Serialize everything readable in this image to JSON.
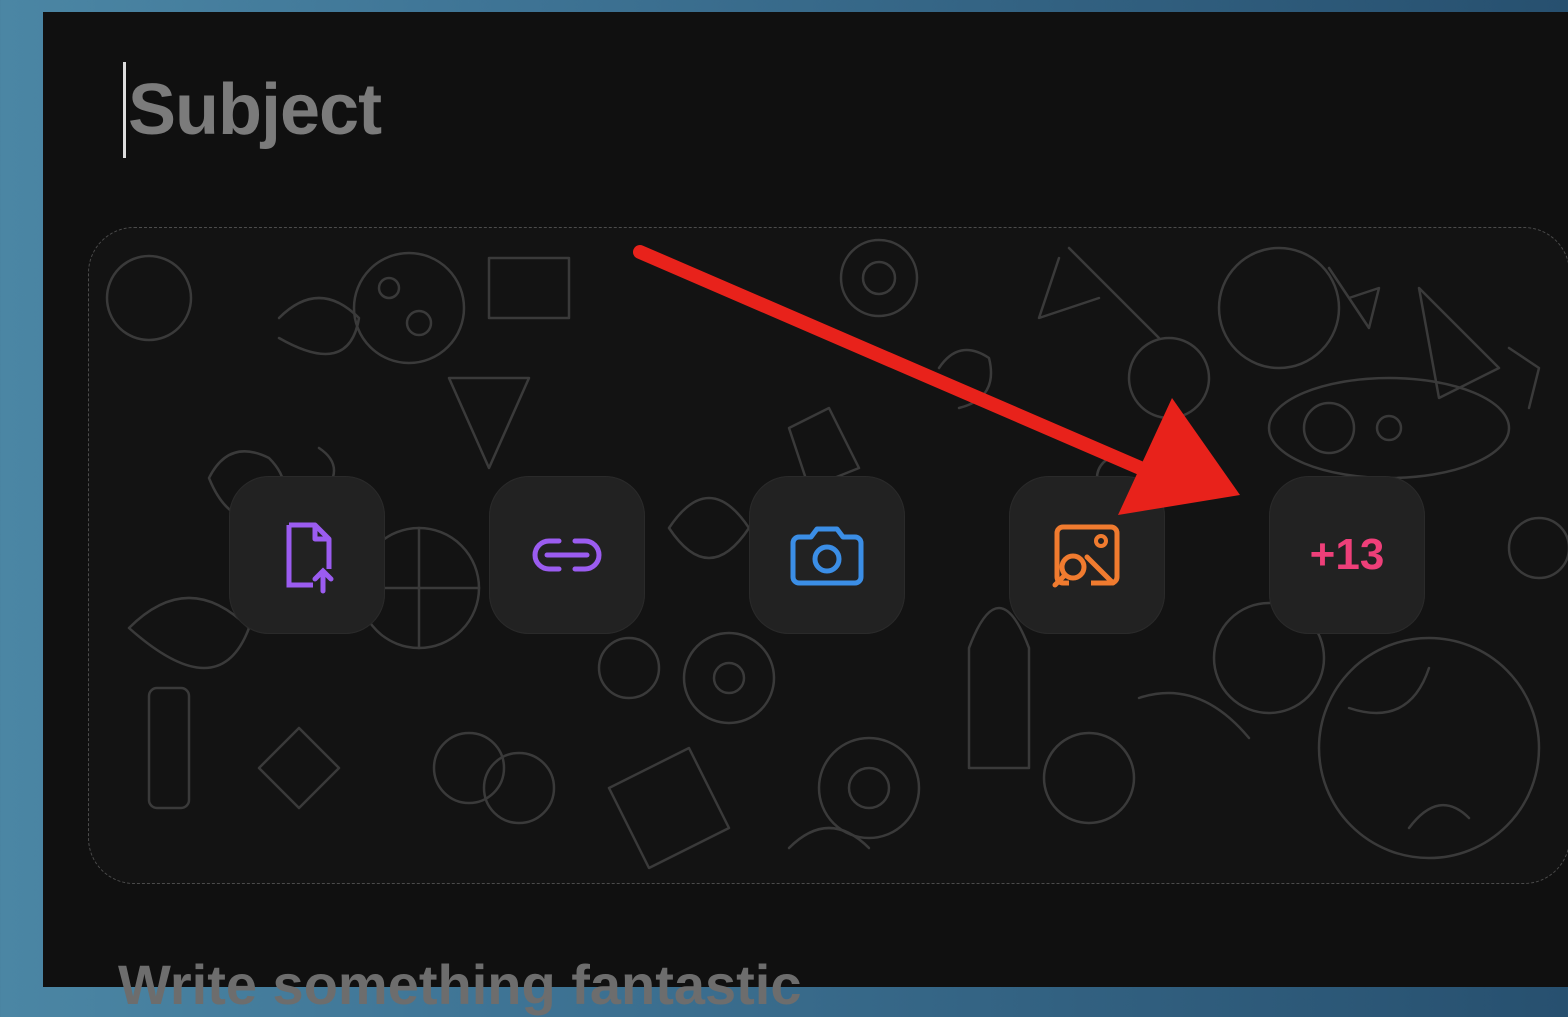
{
  "composer": {
    "subject_placeholder": "Subject",
    "body_placeholder": "Write something fantastic"
  },
  "attachments": {
    "tools": [
      {
        "icon": "file-upload-icon",
        "color": "#9b5cf0"
      },
      {
        "icon": "link-icon",
        "color": "#9b5cf0"
      },
      {
        "icon": "camera-icon",
        "color": "#3b8ee6"
      },
      {
        "icon": "image-search-icon",
        "color": "#f07b2f"
      }
    ],
    "more_label": "+13",
    "more_color": "#ee3f79"
  },
  "annotation": {
    "arrow_color": "#e8221b"
  }
}
